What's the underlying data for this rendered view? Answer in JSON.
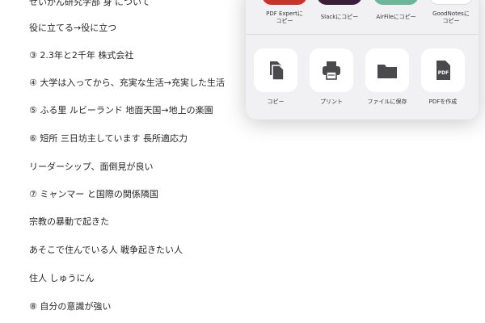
{
  "document": {
    "lines": [
      "せいかん研究学部 身 について",
      "役に立てる→役に立つ",
      "③ 2.3年と2千年 株式会社",
      "④ 大学は入ってから、充実な生活→充実した生活",
      "⑤ ふる里 ルビーランド 地面天国→地上の楽園",
      "⑥ 短所 三日坊主しています 長所適応力",
      "リーダーシップ、面倒見が良い",
      "⑦ ミャンマー と国際の関係隣国",
      "宗教の暴動で起きた",
      "あそこで住んでいる人 戦争起きたい人",
      "住人 しゅうにん",
      "⑧ 自分の意識が強い"
    ]
  },
  "share_sheet": {
    "apps": [
      {
        "label": "PDF Expertに\nコピー",
        "color": "#c8332b"
      },
      {
        "label": "Slackにコピー",
        "color": "#3b1f3a"
      },
      {
        "label": "AirFileにコピー",
        "color": "#6fb59a"
      },
      {
        "label": "GoodNotesに\nコピー",
        "color": "#ffffff"
      }
    ],
    "actions": [
      {
        "label": "コピー",
        "icon": "copy-icon"
      },
      {
        "label": "プリント",
        "icon": "printer-icon"
      },
      {
        "label": "ファイルに保存",
        "icon": "folder-icon"
      },
      {
        "label": "PDFを作成",
        "icon": "pdf-document-icon",
        "icon_text": "PDF"
      }
    ],
    "icon_color": "#4a4a4c"
  }
}
